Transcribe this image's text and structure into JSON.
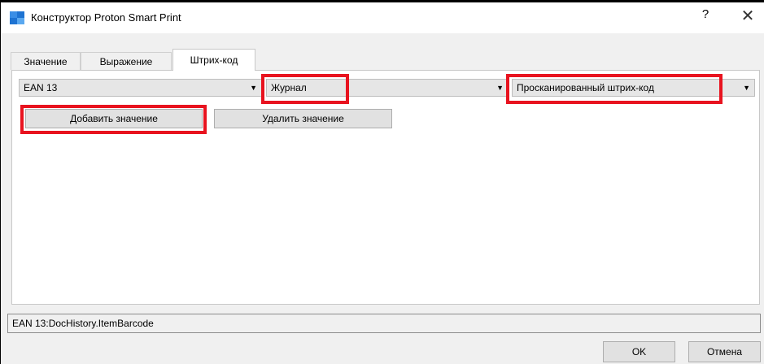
{
  "window": {
    "title": "Конструктор Proton Smart Print",
    "help_label": "?",
    "close_label": "✕",
    "icon": "app-logo-icon",
    "accent_color": "#1e73d2"
  },
  "tabs": [
    {
      "label": "Значение"
    },
    {
      "label": "Выражение"
    },
    {
      "label": "Штрих-код",
      "active": true
    }
  ],
  "barcode": {
    "type_select": "EAN 13",
    "source_select": "Журнал",
    "field_select": "Просканированный штрих-код",
    "add_button": "Добавить значение",
    "remove_button": "Удалить значение"
  },
  "expression": "EAN 13:DocHistory.ItemBarcode",
  "footer": {
    "ok": "OK",
    "cancel": "Отмена"
  },
  "highlight_color": "#e8131f"
}
